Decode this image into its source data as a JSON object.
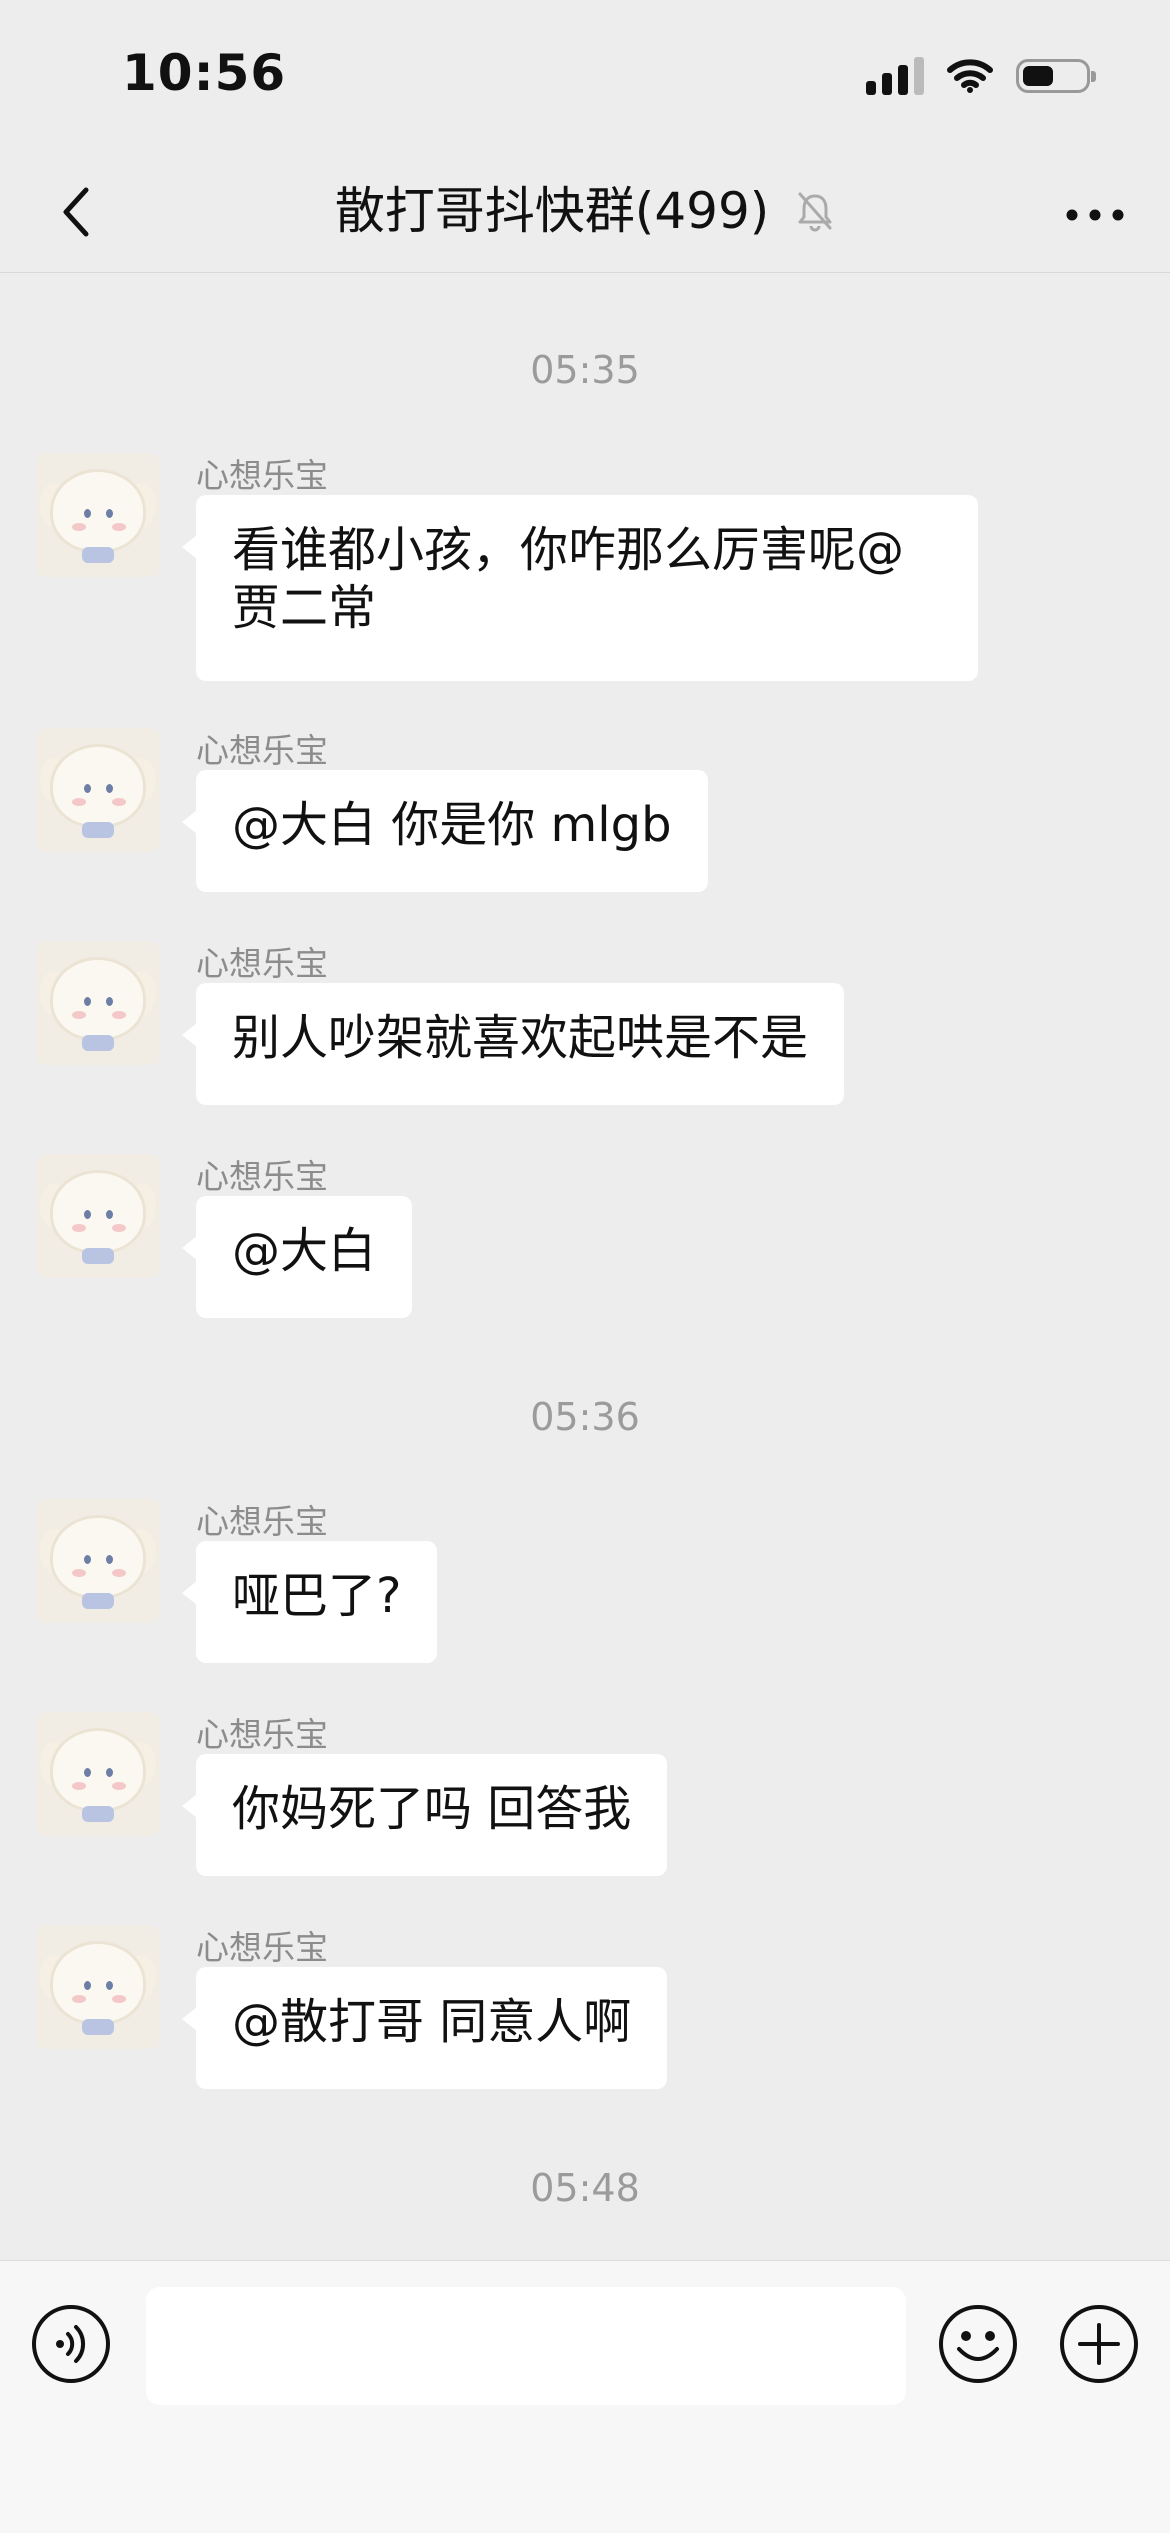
{
  "status_bar": {
    "time": "10:56",
    "icons": [
      "signal-icon",
      "wifi-icon",
      "battery-icon"
    ]
  },
  "header": {
    "title": "散打哥抖快群(499)",
    "back_icon": "chevron-left-icon",
    "mute_icon": "bell-off-icon",
    "more_icon": "more-icon"
  },
  "chat": {
    "timestamps": [
      "05:35",
      "05:36",
      "05:48"
    ],
    "messages": [
      {
        "sender": "心想乐宝",
        "text": "看谁都小孩，你咋那么厉害呢@贾二常"
      },
      {
        "sender": "心想乐宝",
        "text": "@大白 你是你 mlgb"
      },
      {
        "sender": "心想乐宝",
        "text": "别人吵架就喜欢起哄是不是"
      },
      {
        "sender": "心想乐宝",
        "text": "@大白"
      },
      {
        "sender": "心想乐宝",
        "text": "哑巴了?"
      },
      {
        "sender": "心想乐宝",
        "text": "你妈死了吗 回答我"
      },
      {
        "sender": "心想乐宝",
        "text": "@散打哥 同意人啊"
      }
    ]
  },
  "input_bar": {
    "value": "",
    "icons": [
      "voice-icon",
      "emoji-icon",
      "plus-icon"
    ]
  },
  "colors": {
    "background": "#ededed",
    "bubble": "#ffffff",
    "secondary_text": "#9b9b9b"
  }
}
